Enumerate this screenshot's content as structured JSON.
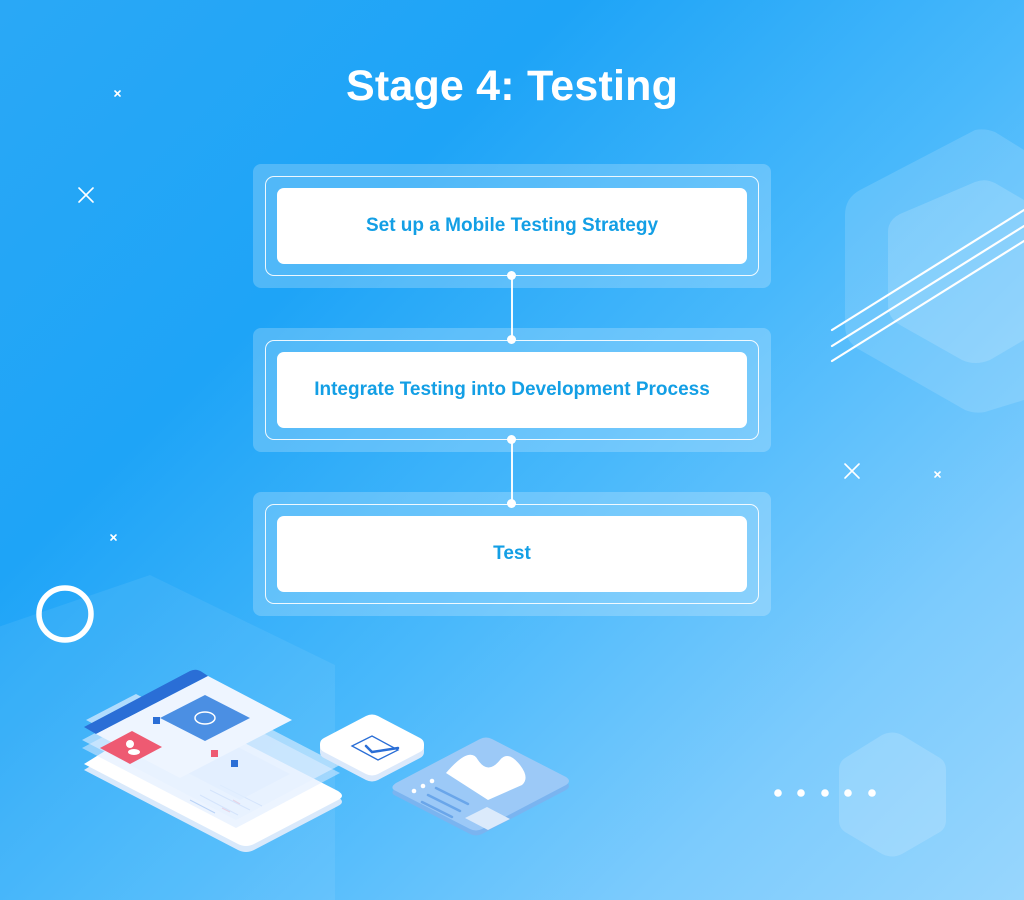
{
  "title": "Stage 4: Testing",
  "steps": [
    {
      "label": "Set up a Mobile Testing Strategy"
    },
    {
      "label": "Integrate Testing into Development Process"
    },
    {
      "label": "Test"
    }
  ],
  "colors": {
    "background_start": "#1ea4f7",
    "background_end": "#98d6fd",
    "step_text": "#139fe5",
    "title_text": "#ffffff",
    "accent_red": "#ee5a72",
    "accent_dark_blue": "#2a6ed6"
  },
  "decorations": {
    "icons": [
      "close-x-icon",
      "ring-icon",
      "dots-icon",
      "diagonal-lines-icon",
      "hexagon-shape"
    ],
    "illustrations": [
      "layered-tablet-illustration",
      "checkbox-tile-illustration",
      "chart-card-illustration"
    ]
  }
}
